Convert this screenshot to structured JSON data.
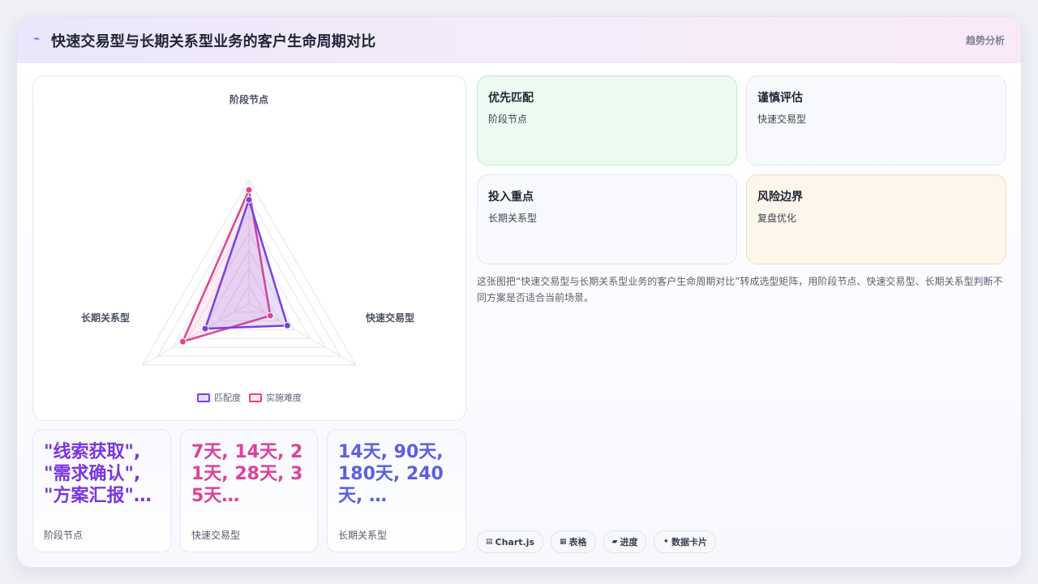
{
  "header": {
    "icon": "trend-line-icon",
    "title": "快速交易型与长期关系型业务的客户生命周期对比",
    "tag": "趋势分析"
  },
  "chart_data": {
    "type": "radar",
    "axes": [
      "阶段节点",
      "快速交易型",
      "长期关系型"
    ],
    "rmax": 1.0,
    "grid_levels": 7,
    "series": [
      {
        "name": "匹配度",
        "values": [
          0.84,
          0.36,
          0.41
        ],
        "color": "#7b3fe4"
      },
      {
        "name": "实施难度",
        "values": [
          0.92,
          0.2,
          0.62
        ],
        "color": "#e0468f"
      }
    ]
  },
  "stats": [
    {
      "value": "\"线索获取\", \"需求确认\", \"方案汇报\"…",
      "label": "阶段节点",
      "color": "#7a35e0"
    },
    {
      "value": "7天, 14天, 21天, 28天, 35天…",
      "label": "快速交易型",
      "color": "#e0409b"
    },
    {
      "value": "14天, 90天, 180天, 240天, …",
      "label": "长期关系型",
      "color": "#5b5fe0"
    }
  ],
  "cards": [
    {
      "title": "优先匹配",
      "value": "阶段节点",
      "bg": "#ecfbf2",
      "border": "#b9ecd0"
    },
    {
      "title": "谨慎评估",
      "value": "快速交易型",
      "bg": "#f8f9fc",
      "border": "#e2e6f0"
    },
    {
      "title": "投入重点",
      "value": "长期关系型",
      "bg": "#f8f9fc",
      "border": "#e2e6f0"
    },
    {
      "title": "风险边界",
      "value": "复盘优化",
      "bg": "#fdf6ea",
      "border": "#f3dcb6"
    }
  ],
  "description": "这张图把“快速交易型与长期关系型业务的客户生命周期对比”转成选型矩阵，用阶段节点、快速交易型、长期关系型判断不同方案是否适合当前场景。",
  "chips": [
    {
      "icon": "▤",
      "label": "Chart.js"
    },
    {
      "icon": "▦",
      "label": "表格"
    },
    {
      "icon": "▰",
      "label": "进度"
    },
    {
      "icon": "✦",
      "label": "数据卡片"
    }
  ]
}
